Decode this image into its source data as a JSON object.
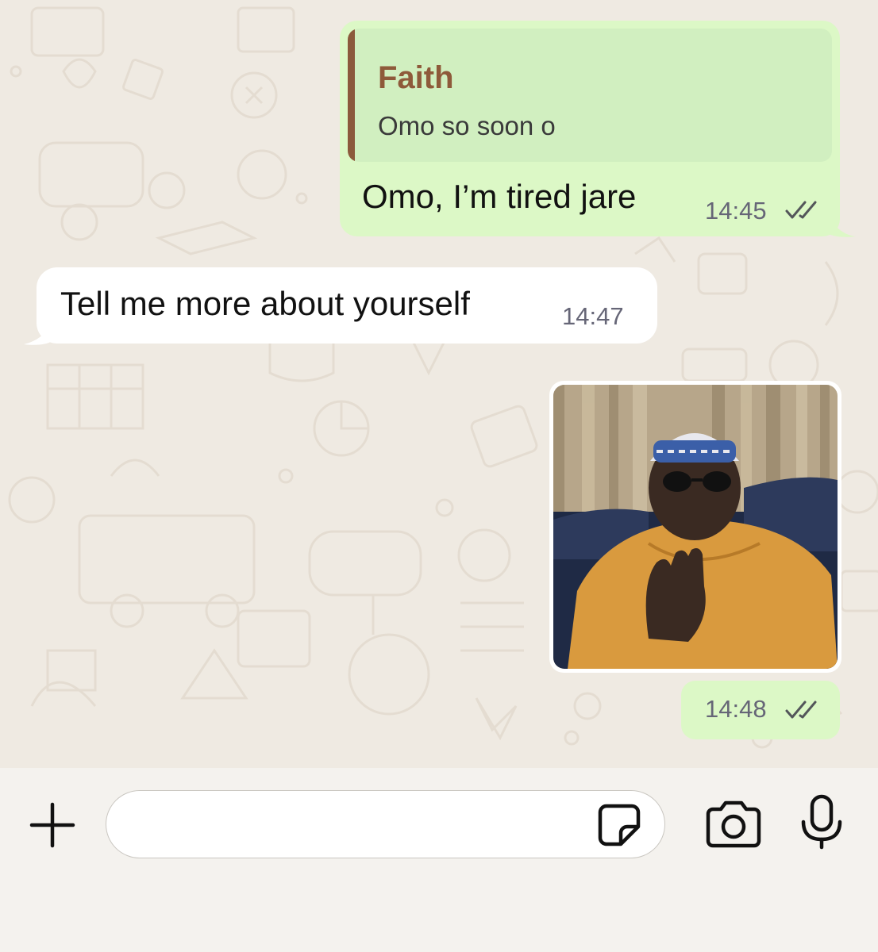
{
  "messages": [
    {
      "direction": "outgoing",
      "reply_to": {
        "author": "Faith",
        "text": "Omo so soon o"
      },
      "text": "Omo, I’m tired jare",
      "time": "14:45",
      "status": "read"
    },
    {
      "direction": "incoming",
      "text": "Tell me more about yourself",
      "time": "14:47"
    },
    {
      "direction": "outgoing",
      "type": "image",
      "image_description": "GIF of a man in an orange kaftan, patterned cap and sunglasses, waving his hand dismissively",
      "time": "14:48",
      "status": "read"
    }
  ],
  "input_bar": {
    "plus_icon": "plus-icon",
    "placeholder": "",
    "sticker_icon": "sticker-icon",
    "camera_icon": "camera-icon",
    "mic_icon": "microphone-icon"
  },
  "colors": {
    "chat_background": "#efeae2",
    "outgoing_bubble": "#dcf8c6",
    "incoming_bubble": "#ffffff",
    "quote_bar": "#8b5a3c",
    "read_ticks": "#53565a"
  }
}
